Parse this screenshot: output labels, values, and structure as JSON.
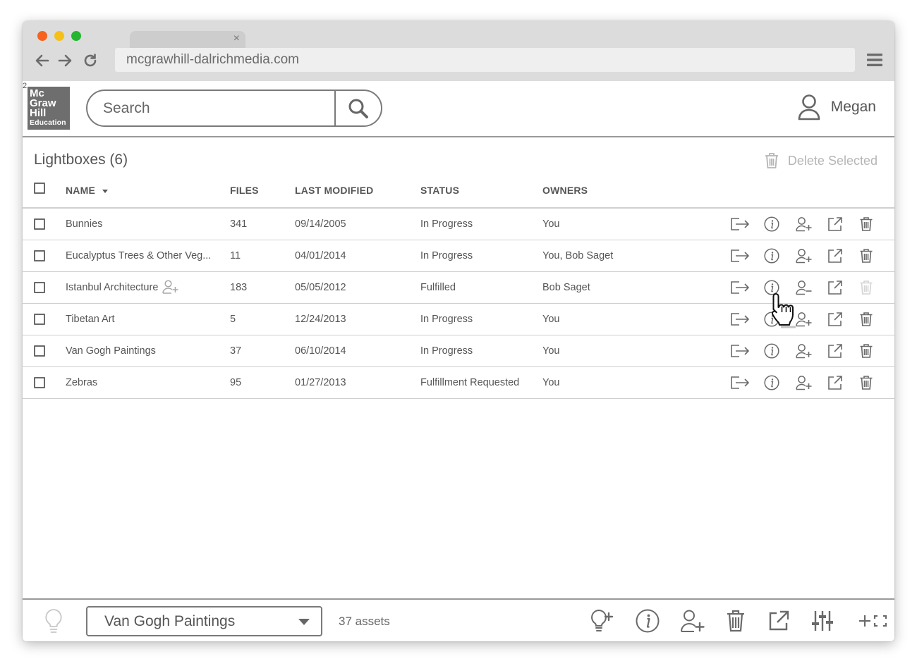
{
  "browser": {
    "url": "mcgrawhill-dalrichmedia.com",
    "tab_close": "×",
    "dot_colors": [
      "#f5631f",
      "#f5c01a",
      "#25b530"
    ]
  },
  "header": {
    "logo_number": "2",
    "logo_lines": [
      "Mc",
      "Graw",
      "Hill",
      "Education"
    ],
    "search_placeholder": "Search",
    "user_name": "Megan"
  },
  "lightboxes": {
    "title": "Lightboxes (6)",
    "delete_selected": "Delete Selected",
    "columns": [
      "NAME",
      "FILES",
      "LAST MODIFIED",
      "STATUS",
      "OWNERS"
    ],
    "rows": [
      {
        "name": "Bunnies",
        "files": "341",
        "modified": "09/14/2005",
        "status": "In Progress",
        "owners": "You"
      },
      {
        "name": "Eucalyptus Trees & Other Veg...",
        "files": "11",
        "modified": "04/01/2014",
        "status": "In Progress",
        "owners": "You, Bob Saget"
      },
      {
        "name": "Istanbul Architecture",
        "files": "183",
        "modified": "05/05/2012",
        "status": "Fulfilled",
        "owners": "Bob Saget"
      },
      {
        "name": "Tibetan Art",
        "files": "5",
        "modified": "12/24/2013",
        "status": "In Progress",
        "owners": "You"
      },
      {
        "name": "Van Gogh Paintings",
        "files": "37",
        "modified": "06/10/2014",
        "status": "In Progress",
        "owners": "You"
      },
      {
        "name": "Zebras",
        "files": "95",
        "modified": "01/27/2013",
        "status": "Fulfillment Requested",
        "owners": "You"
      }
    ]
  },
  "footer": {
    "selected_lightbox": "Van Gogh Paintings",
    "assets": "37 assets"
  }
}
